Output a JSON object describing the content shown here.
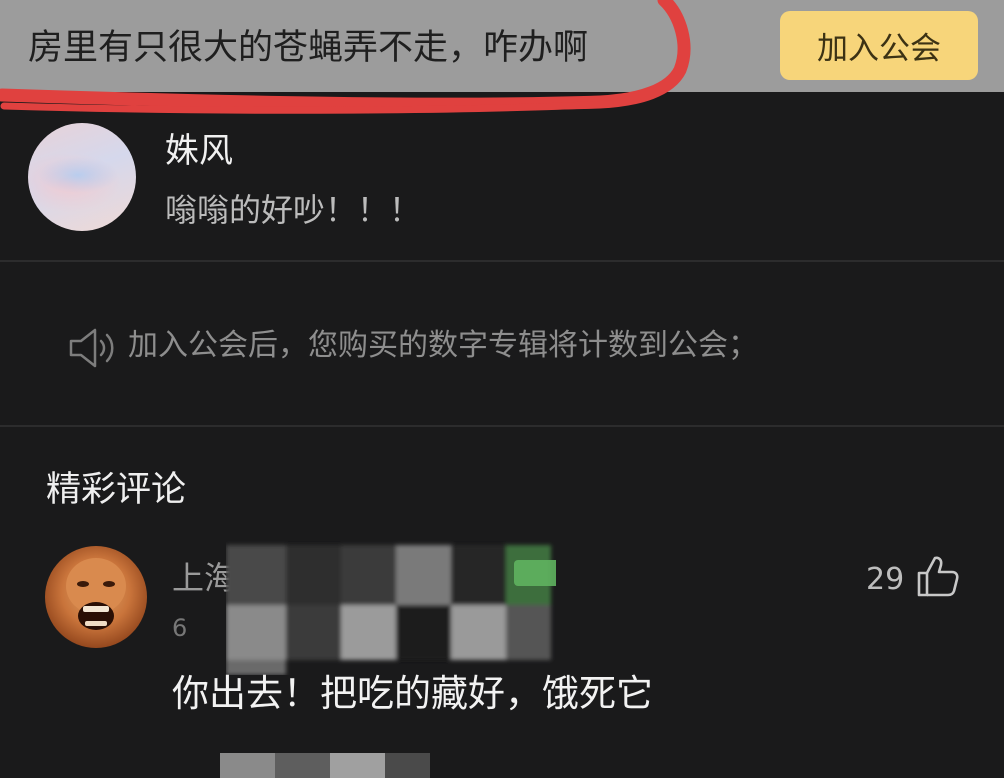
{
  "header": {
    "title": "房里有只很大的苍蝇弄不走，咋办啊",
    "join_label": "加入公会"
  },
  "post": {
    "username": "姝风",
    "text": "嗡嗡的好吵！！！"
  },
  "notice": {
    "icon": "speaker-icon",
    "text": "加入公会后，您购买的数字专辑将计数到公会；"
  },
  "comments": {
    "section_title": "精彩评论",
    "items": [
      {
        "username_visible": "上海",
        "meta_visible": "6",
        "likes": "29",
        "text": "你出去！把吃的藏好，饿死它"
      }
    ]
  },
  "colors": {
    "header_bg": "#9c9c9c",
    "join_button": "#f7d57a",
    "page_bg": "#1a1a1b",
    "highlight_stroke": "#e0413f"
  }
}
